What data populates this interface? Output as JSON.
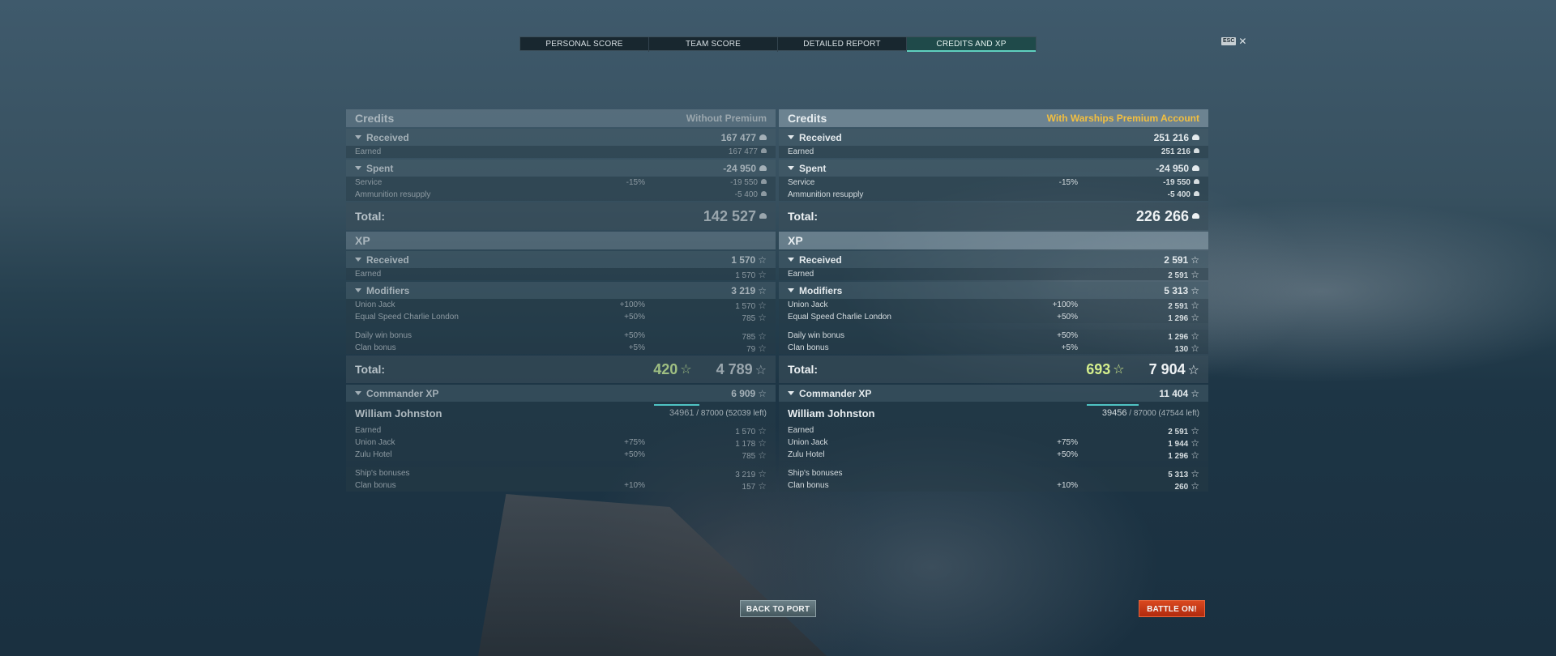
{
  "tabs": [
    "PERSONAL SCORE",
    "TEAM SCORE",
    "DETAILED REPORT",
    "CREDITS AND XP"
  ],
  "active_tab": "CREDITS AND XP",
  "esc_label": "ESC",
  "close_glyph": "✕",
  "icons": {
    "credit": "credit-icon",
    "xp": "xp-star-icon",
    "caret": "chevron-down-icon"
  },
  "colors": {
    "active_tab": "#5fd0bf",
    "premium_label": "#f3bf3f",
    "free_xp": "#d4ee8c",
    "battle_button": "#c8361a",
    "progress_bar": "#4fc3c3"
  },
  "panels": [
    {
      "credits_title": "Credits",
      "account_note": "Without Premium",
      "credits": {
        "received": {
          "label": "Received",
          "value": "167 477"
        },
        "earned": {
          "label": "Earned",
          "value": "167 477"
        },
        "spent": {
          "label": "Spent",
          "value": "-24 950"
        },
        "service": {
          "label": "Service",
          "pct": "-15%",
          "value": "-19 550"
        },
        "ammo": {
          "label": "Ammunition resupply",
          "value": "-5 400"
        },
        "total": {
          "label": "Total:",
          "value": "142 527"
        }
      },
      "xp_title": "XP",
      "xp": {
        "received": {
          "label": "Received",
          "value": "1 570"
        },
        "earned": {
          "label": "Earned",
          "value": "1 570"
        },
        "modifiers": {
          "label": "Modifiers",
          "value": "3 219"
        },
        "union_jack": {
          "label": "Union Jack",
          "pct": "+100%",
          "value": "1 570"
        },
        "equal_speed": {
          "label": "Equal Speed Charlie London",
          "pct": "+50%",
          "value": "785"
        },
        "daily_win": {
          "label": "Daily win bonus",
          "pct": "+50%",
          "value": "785"
        },
        "clan": {
          "label": "Clan bonus",
          "pct": "+5%",
          "value": "79"
        },
        "total": {
          "label": "Total:",
          "free_xp": "420",
          "value": "4 789"
        }
      },
      "commander": {
        "section": {
          "label": "Commander XP",
          "value": "6 909"
        },
        "name": "William Johnston",
        "current": "34961",
        "rest": "/ 87000 (52039 left)",
        "progress": 0.402,
        "earned": {
          "label": "Earned",
          "value": "1 570"
        },
        "union_jack": {
          "label": "Union Jack",
          "pct": "+75%",
          "value": "1 178"
        },
        "zulu_hotel": {
          "label": "Zulu Hotel",
          "pct": "+50%",
          "value": "785"
        },
        "ship_bonuses": {
          "label": "Ship's bonuses",
          "value": "3 219"
        },
        "clan": {
          "label": "Clan bonus",
          "pct": "+10%",
          "value": "157"
        }
      }
    },
    {
      "credits_title": "Credits",
      "account_note": "With Warships Premium Account",
      "credits": {
        "received": {
          "label": "Received",
          "value": "251 216"
        },
        "earned": {
          "label": "Earned",
          "value": "251 216"
        },
        "spent": {
          "label": "Spent",
          "value": "-24 950"
        },
        "service": {
          "label": "Service",
          "pct": "-15%",
          "value": "-19 550"
        },
        "ammo": {
          "label": "Ammunition resupply",
          "value": "-5 400"
        },
        "total": {
          "label": "Total:",
          "value": "226 266"
        }
      },
      "xp_title": "XP",
      "xp": {
        "received": {
          "label": "Received",
          "value": "2 591"
        },
        "earned": {
          "label": "Earned",
          "value": "2 591"
        },
        "modifiers": {
          "label": "Modifiers",
          "value": "5 313"
        },
        "union_jack": {
          "label": "Union Jack",
          "pct": "+100%",
          "value": "2 591"
        },
        "equal_speed": {
          "label": "Equal Speed Charlie London",
          "pct": "+50%",
          "value": "1 296"
        },
        "daily_win": {
          "label": "Daily win bonus",
          "pct": "+50%",
          "value": "1 296"
        },
        "clan": {
          "label": "Clan bonus",
          "pct": "+5%",
          "value": "130"
        },
        "total": {
          "label": "Total:",
          "free_xp": "693",
          "value": "7 904"
        }
      },
      "commander": {
        "section": {
          "label": "Commander XP",
          "value": "11 404"
        },
        "name": "William Johnston",
        "current": "39456",
        "rest": "/ 87000 (47544 left)",
        "progress": 0.454,
        "earned": {
          "label": "Earned",
          "value": "2 591"
        },
        "union_jack": {
          "label": "Union Jack",
          "pct": "+75%",
          "value": "1 944"
        },
        "zulu_hotel": {
          "label": "Zulu Hotel",
          "pct": "+50%",
          "value": "1 296"
        },
        "ship_bonuses": {
          "label": "Ship's bonuses",
          "value": "5 313"
        },
        "clan": {
          "label": "Clan bonus",
          "pct": "+10%",
          "value": "260"
        }
      }
    }
  ],
  "buttons": {
    "back": "BACK TO PORT",
    "battle": "BATTLE ON!"
  }
}
